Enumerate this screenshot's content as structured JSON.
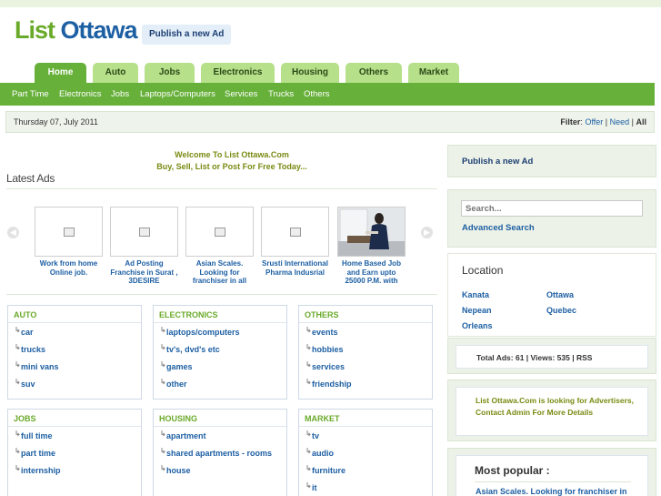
{
  "site": {
    "logo_part1": "List",
    "logo_part2": "Ottawa",
    "publish_label": "Publish a new Ad"
  },
  "tabs": [
    "Home",
    "Auto",
    "Jobs",
    "Electronics",
    "Housing",
    "Others",
    "Market"
  ],
  "subnav": [
    "Part Time",
    "Electronics",
    "Jobs",
    "Laptops/Computers",
    "Services",
    "Trucks",
    "Others"
  ],
  "datebar": {
    "date": "Thursday 07, July 2011",
    "filter_label": "Filter",
    "filter_offer": "Offer",
    "filter_need": "Need",
    "filter_all": "All"
  },
  "welcome": {
    "line1": "Welcome To List Ottawa.Com",
    "line2": "Buy, Sell, List or Post For Free Today..."
  },
  "latest": {
    "title": "Latest Ads",
    "ads": [
      {
        "title": "Work from home Online job.",
        "has_photo": false
      },
      {
        "title": "Ad Posting Franchise in Surat , 3DESIRE",
        "has_photo": false
      },
      {
        "title": "Asian Scales. Looking for franchiser in all",
        "has_photo": false
      },
      {
        "title": "Srusti International Pharma Indusrial",
        "has_photo": false
      },
      {
        "title": "Home Based Job and Earn upto 25000 P.M. with",
        "has_photo": true
      }
    ]
  },
  "categories": [
    {
      "name": "AUTO",
      "items": [
        "car",
        "trucks",
        "mini vans",
        "suv"
      ]
    },
    {
      "name": "ELECTRONICS",
      "items": [
        "laptops/computers",
        "tv's, dvd's etc",
        "games",
        "other"
      ]
    },
    {
      "name": "OTHERS",
      "items": [
        "events",
        "hobbies",
        "services",
        "friendship"
      ]
    },
    {
      "name": "JOBS",
      "items": [
        "full time",
        "part time",
        "internship"
      ]
    },
    {
      "name": "HOUSING",
      "items": [
        "apartment",
        "shared apartments - rooms",
        "house"
      ]
    },
    {
      "name": "MARKET",
      "items": [
        "tv",
        "audio",
        "furniture",
        "it"
      ]
    }
  ],
  "sidebar": {
    "publish_label": "Publish a new Ad",
    "search_placeholder": "Search...",
    "advanced_search": "Advanced Search",
    "location_title": "Location",
    "locations": [
      "Kanata",
      "Ottawa",
      "Nepean",
      "Quebec",
      "Orleans"
    ],
    "stats_text": "Total Ads: 61 | Views: 535 | RSS",
    "advertise_text": "List Ottawa.Com is looking for Advertisers, Contact Admin For More Details",
    "popular_title": "Most popular :",
    "popular_item": "Asian Scales. Looking for franchiser in"
  },
  "colors": {
    "green": "#67b03a",
    "light_green": "#b6e08a",
    "link_blue": "#1d5fa3",
    "olive": "#7a8a12"
  }
}
